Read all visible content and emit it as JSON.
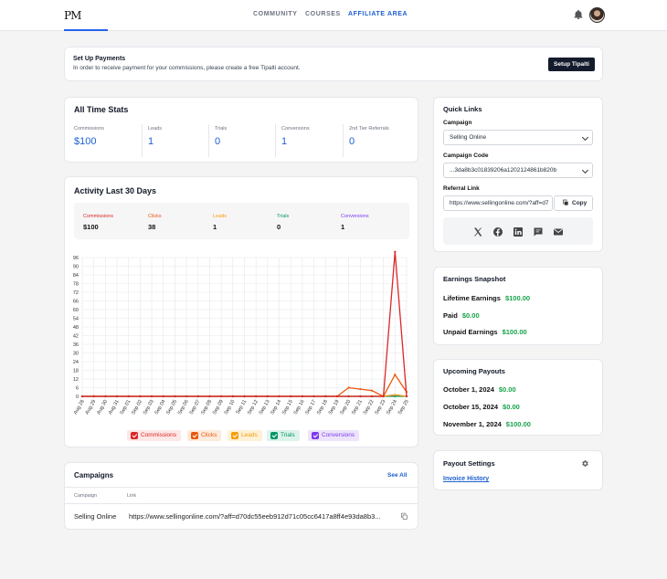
{
  "header": {
    "logo": "PM",
    "nav": [
      "COMMUNITY",
      "COURSES",
      "AFFILIATE AREA"
    ]
  },
  "payments_banner": {
    "title": "Set Up Payments",
    "text": "In order to receive payment for your commissions, please create a free Tipalti account.",
    "button": "Setup Tipalti"
  },
  "all_time_stats": {
    "title": "All Time Stats",
    "items": [
      {
        "label": "Commissions",
        "value": "$100"
      },
      {
        "label": "Leads",
        "value": "1"
      },
      {
        "label": "Trials",
        "value": "0"
      },
      {
        "label": "Conversions",
        "value": "1"
      },
      {
        "label": "2nd Tier Referrals",
        "value": "0"
      }
    ]
  },
  "activity": {
    "title": "Activity Last 30 Days",
    "summary": [
      {
        "label": "Commissions",
        "value": "$100",
        "color": "#dc2626"
      },
      {
        "label": "Clicks",
        "value": "38",
        "color": "#ea580c"
      },
      {
        "label": "Leads",
        "value": "1",
        "color": "#f59e0b"
      },
      {
        "label": "Trials",
        "value": "0",
        "color": "#059669"
      },
      {
        "label": "Conversions",
        "value": "1",
        "color": "#7c3aed"
      }
    ]
  },
  "chart_data": {
    "type": "line",
    "ylim": [
      0,
      96
    ],
    "yticks": [
      0,
      6,
      12,
      18,
      24,
      30,
      36,
      42,
      48,
      54,
      60,
      66,
      72,
      78,
      84,
      90,
      96
    ],
    "x": [
      "Aug 28",
      "Aug 29",
      "Aug 30",
      "Aug 31",
      "Sep 01",
      "Sep 02",
      "Sep 03",
      "Sep 04",
      "Sep 05",
      "Sep 06",
      "Sep 07",
      "Sep 08",
      "Sep 09",
      "Sep 10",
      "Sep 11",
      "Sep 12",
      "Sep 13",
      "Sep 14",
      "Sep 15",
      "Sep 16",
      "Sep 17",
      "Sep 18",
      "Sep 19",
      "Sep 20",
      "Sep 21",
      "Sep 22",
      "Sep 23",
      "Sep 24",
      "Sep 25"
    ],
    "series": [
      {
        "name": "Commissions",
        "color": "#dc2626",
        "values": [
          0,
          0,
          0,
          0,
          0,
          0,
          0,
          0,
          0,
          0,
          0,
          0,
          0,
          0,
          0,
          0,
          0,
          0,
          0,
          0,
          0,
          0,
          0,
          0,
          0,
          0,
          0,
          100,
          0
        ]
      },
      {
        "name": "Clicks",
        "color": "#ea580c",
        "values": [
          0,
          0,
          0,
          0,
          0,
          0,
          0,
          0,
          0,
          0,
          0,
          0,
          0,
          0,
          0,
          0,
          0,
          0,
          0,
          0,
          0,
          0,
          0,
          6,
          5,
          4,
          0,
          15,
          3
        ]
      },
      {
        "name": "Leads",
        "color": "#f59e0b",
        "values": [
          0,
          0,
          0,
          0,
          0,
          0,
          0,
          0,
          0,
          0,
          0,
          0,
          0,
          0,
          0,
          0,
          0,
          0,
          0,
          0,
          0,
          0,
          0,
          0,
          0,
          0,
          0,
          1,
          0
        ]
      },
      {
        "name": "Trials",
        "color": "#059669",
        "values": [
          0,
          0,
          0,
          0,
          0,
          0,
          0,
          0,
          0,
          0,
          0,
          0,
          0,
          0,
          0,
          0,
          0,
          0,
          0,
          0,
          0,
          0,
          0,
          0,
          0,
          0,
          0,
          0,
          0
        ]
      },
      {
        "name": "Conversions",
        "color": "#7c3aed",
        "values": [
          0,
          0,
          0,
          0,
          0,
          0,
          0,
          0,
          0,
          0,
          0,
          0,
          0,
          0,
          0,
          0,
          0,
          0,
          0,
          0,
          0,
          0,
          0,
          0,
          0,
          0,
          0,
          1,
          0
        ]
      }
    ],
    "grid": true,
    "legend": "bottom"
  },
  "campaigns": {
    "title": "Campaigns",
    "see_all": "See All",
    "columns": [
      "Campaign",
      "Link"
    ],
    "rows": [
      {
        "campaign": "Selling Online",
        "link": "https://www.sellingonline.com/?aff=d70dc55eeb912d71c05cc6417a8ff4e93da8b3..."
      }
    ]
  },
  "quick_links": {
    "title": "Quick Links",
    "campaign_label": "Campaign",
    "campaign_value": "Selling Online",
    "code_label": "Campaign Code",
    "code_value": "...3da8b3c01839206a1202124861b820b",
    "referral_label": "Referral Link",
    "referral_value": "https://www.sellingonline.com/?aff=d7",
    "copy": "Copy",
    "social_icons": [
      "x-icon",
      "facebook-icon",
      "linkedin-icon",
      "sms-icon",
      "email-icon"
    ]
  },
  "earnings": {
    "title": "Earnings Snapshot",
    "rows": [
      {
        "label": "Lifetime Earnings",
        "value": "$100.00"
      },
      {
        "label": "Paid",
        "value": "$0.00"
      },
      {
        "label": "Unpaid Earnings",
        "value": "$100.00"
      }
    ]
  },
  "payouts": {
    "title": "Upcoming Payouts",
    "rows": [
      {
        "date": "October 1, 2024",
        "value": "$0.00"
      },
      {
        "date": "October 15, 2024",
        "value": "$0.00"
      },
      {
        "date": "November 1, 2024",
        "value": "$100.00"
      }
    ]
  },
  "payout_settings": {
    "title": "Payout Settings",
    "link": "Invoice History"
  }
}
